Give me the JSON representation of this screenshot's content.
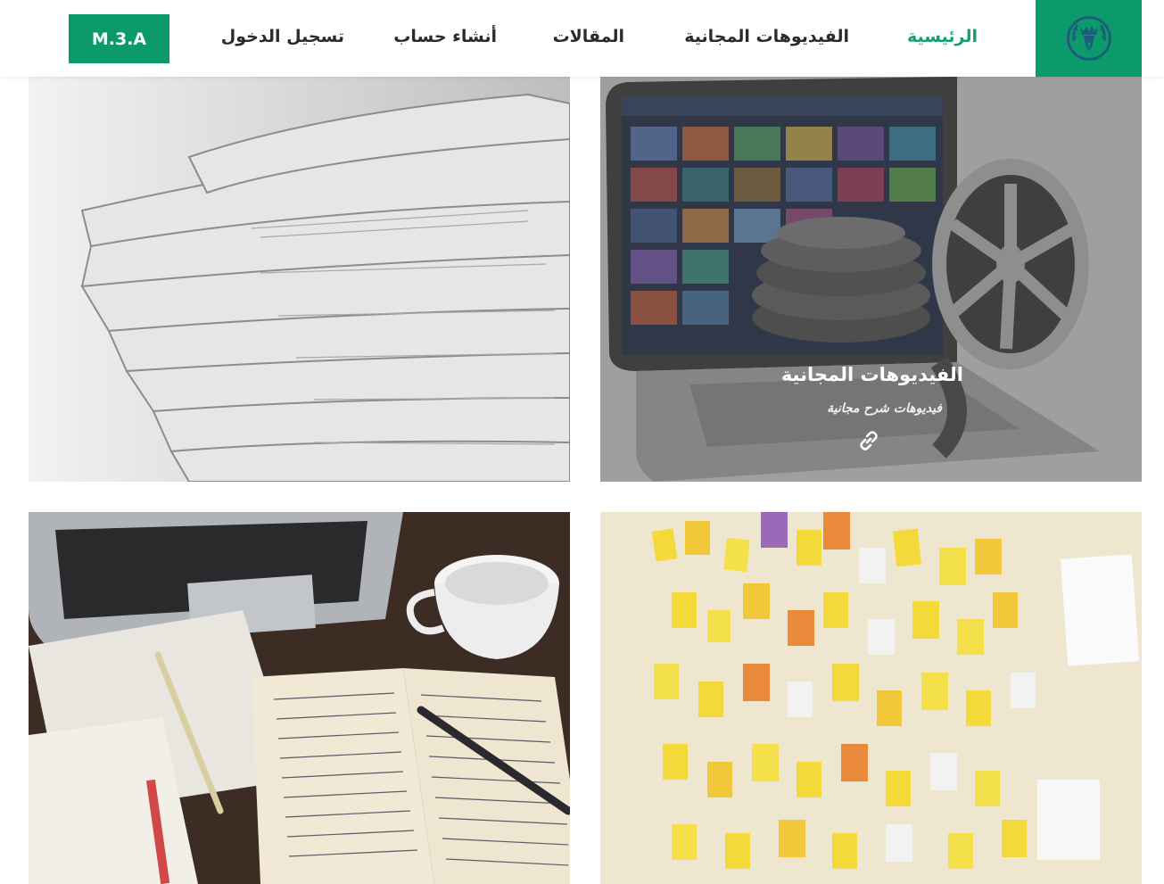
{
  "header": {
    "logo_icon": "pen-crown-laurel-icon",
    "brand_label": "M.3.A",
    "accent_color": "#0d9a6b",
    "active_color": "#14a06d",
    "nav": [
      {
        "label": "الرئيسية",
        "active": true
      },
      {
        "label": "الفيديوهات المجانية",
        "active": false
      },
      {
        "label": "المقالات",
        "active": false
      },
      {
        "label": "أنشاء حساب",
        "active": false
      },
      {
        "label": "تسجيل الدخول",
        "active": false
      }
    ]
  },
  "cards": [
    {
      "image": "laptop-film-reel-image",
      "title": "الفيديوهات المجانية",
      "subtitle": "فيديوهات شرح مجانية",
      "link_icon": "link-icon",
      "hovered": true
    },
    {
      "image": "newspaper-stack-image"
    },
    {
      "image": "sticky-notes-board-image"
    },
    {
      "image": "notebook-laptop-coffee-image"
    }
  ]
}
